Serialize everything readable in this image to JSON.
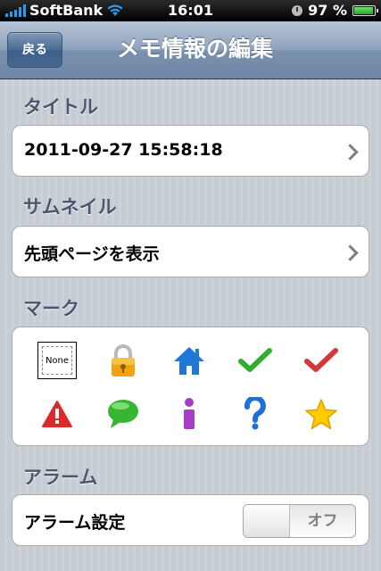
{
  "status_bar": {
    "carrier": "SoftBank",
    "time": "16:01",
    "battery_text": "97 %",
    "battery_level": 0.97
  },
  "nav": {
    "back_label": "戻る",
    "title": "メモ情報の編集"
  },
  "sections": {
    "title": {
      "header": "タイトル",
      "value": "2011-09-27 15:58:18"
    },
    "thumbnail": {
      "header": "サムネイル",
      "value": "先頭ページを表示"
    },
    "mark": {
      "header": "マーク",
      "none_label": "None",
      "icons": [
        "none-icon",
        "lock-icon",
        "home-icon",
        "check-green-icon",
        "check-red-icon",
        "warning-icon",
        "speech-bubble-icon",
        "info-icon",
        "question-icon",
        "star-icon"
      ],
      "colors": {
        "lock": "#f2a20f",
        "home": "#1f78d8",
        "check_green": "#2fae2f",
        "check_red": "#d23a3a",
        "warning": "#d92b2b",
        "bubble": "#36b632",
        "info": "#a43fc4",
        "question": "#1f6fd9",
        "star": "#ffcc00"
      }
    },
    "alarm": {
      "header": "アラーム",
      "label": "アラーム設定",
      "toggle_state": "オフ"
    }
  }
}
